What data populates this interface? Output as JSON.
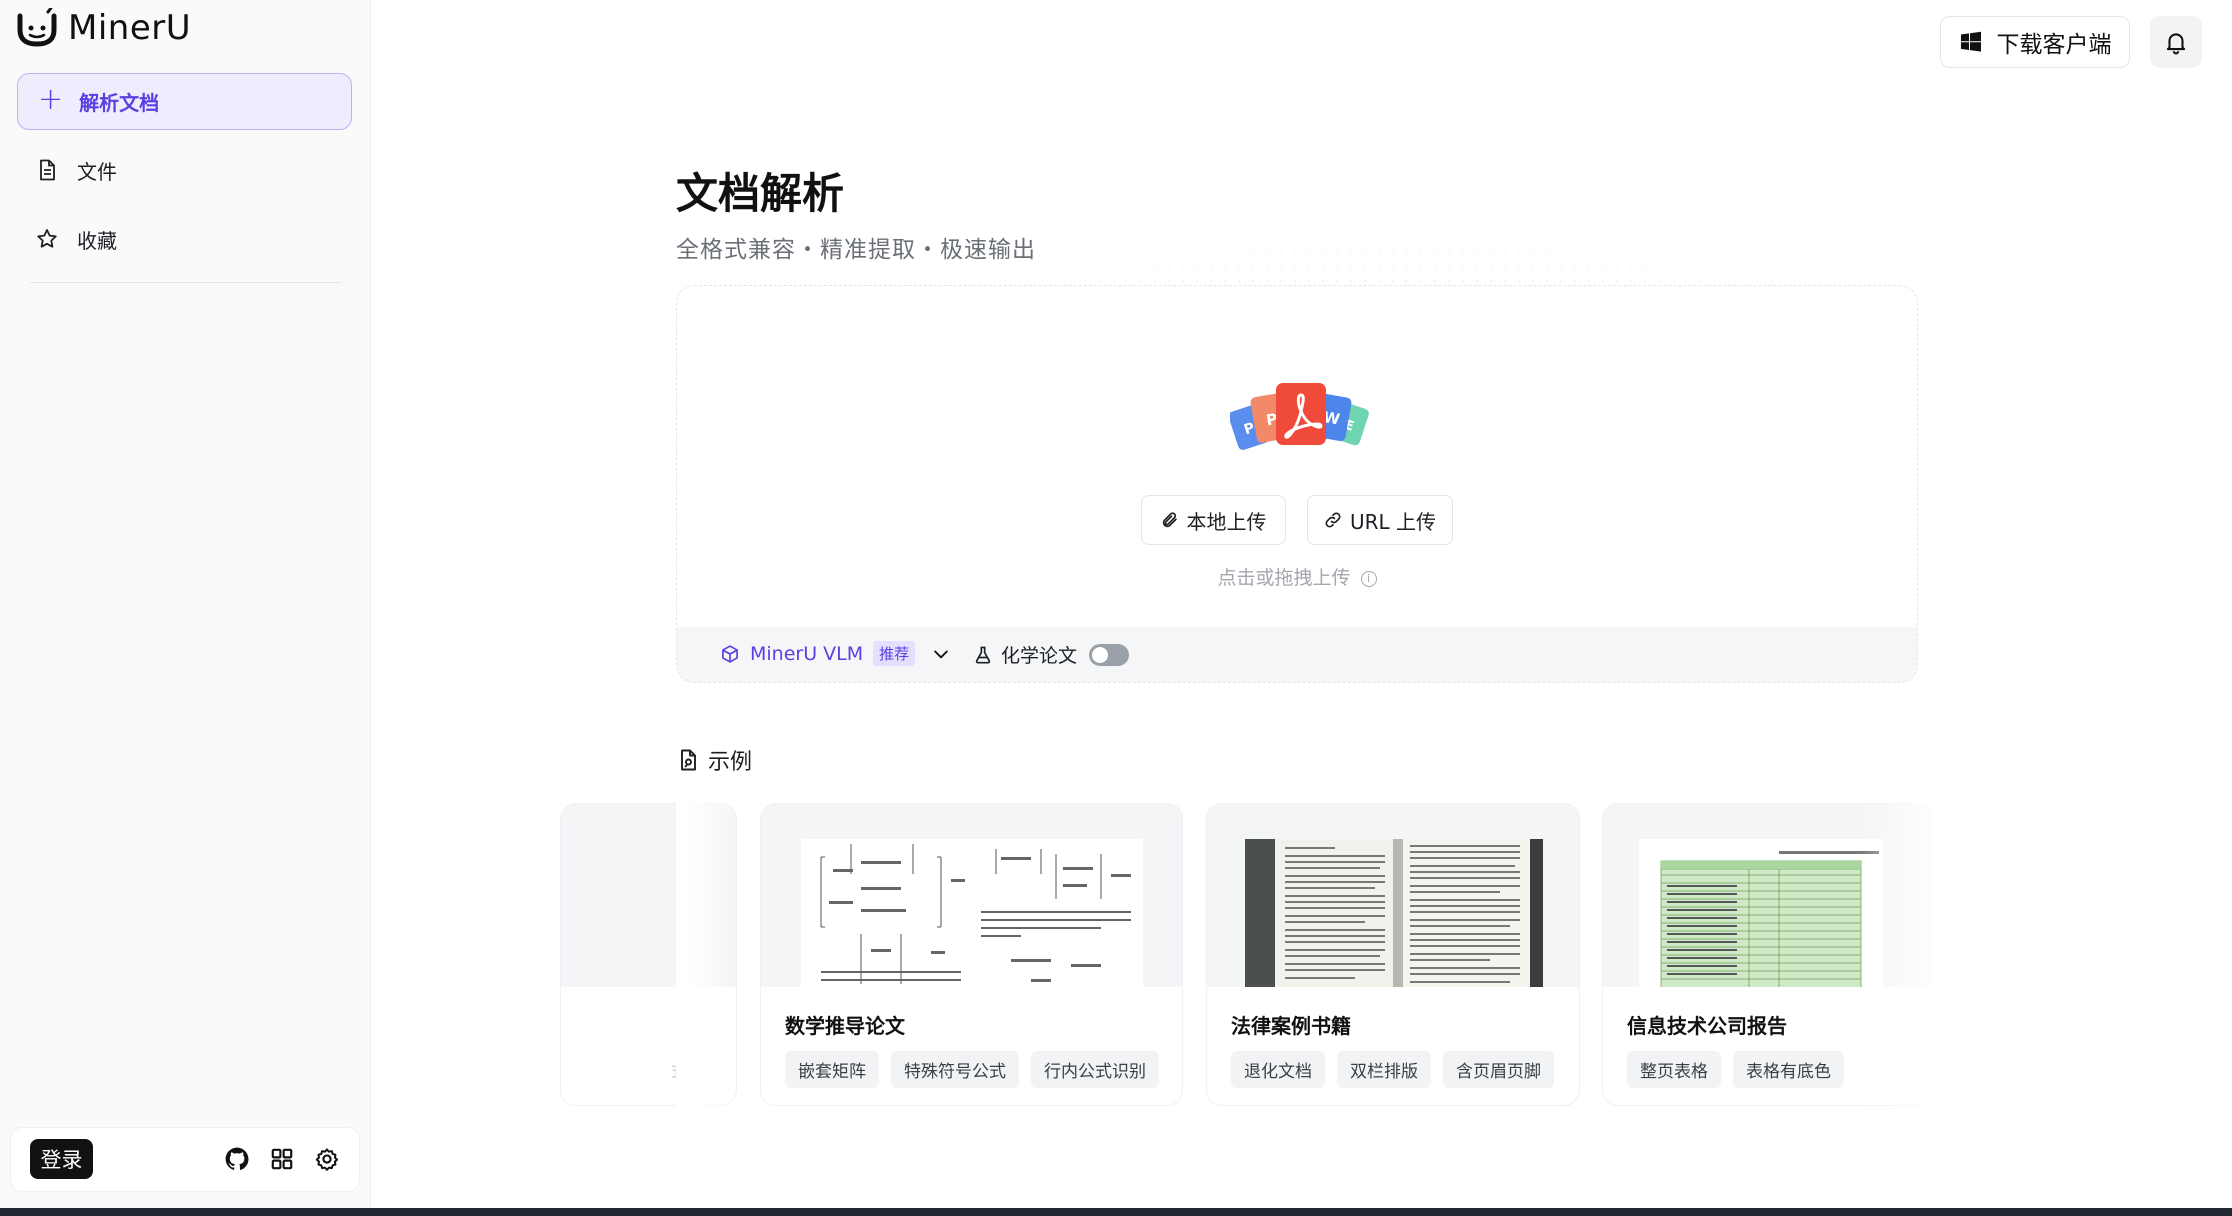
{
  "brand": {
    "name": "MinerU"
  },
  "sidebar": {
    "new_button": "解析文档",
    "items": [
      {
        "label": "文件",
        "icon": "file-icon"
      },
      {
        "label": "收藏",
        "icon": "star-icon"
      }
    ],
    "login": "登录",
    "bottom_icons": [
      "github-icon",
      "apps-grid-icon",
      "settings-gear-icon"
    ]
  },
  "header": {
    "download_label": "下载客户端",
    "notification_icon": "bell-icon"
  },
  "main": {
    "title": "文档解析",
    "subtitle": "全格式兼容・精准提取・极速输出",
    "upload": {
      "local_label": "本地上传",
      "url_label": "URL 上传",
      "hint": "点击或拖拽上传"
    },
    "options": {
      "model": "MinerU VLM",
      "model_badge": "推荐",
      "chem_label": "化学论文",
      "chem_enabled": false
    },
    "examples": {
      "title": "示例",
      "partial_tag": "式",
      "cards": [
        {
          "title": "数学推导论文",
          "tags": [
            "嵌套矩阵",
            "特殊符号公式",
            "行内公式识别"
          ]
        },
        {
          "title": "法律案例书籍",
          "tags": [
            "退化文档",
            "双栏排版",
            "含页眉页脚"
          ]
        },
        {
          "title": "信息技术公司报告",
          "tags": [
            "整页表格",
            "表格有底色"
          ]
        }
      ]
    }
  },
  "colors": {
    "accent": "#5b3fe0",
    "accent_bg": "#eeecfd",
    "pdf_red": "#f04a3a"
  }
}
